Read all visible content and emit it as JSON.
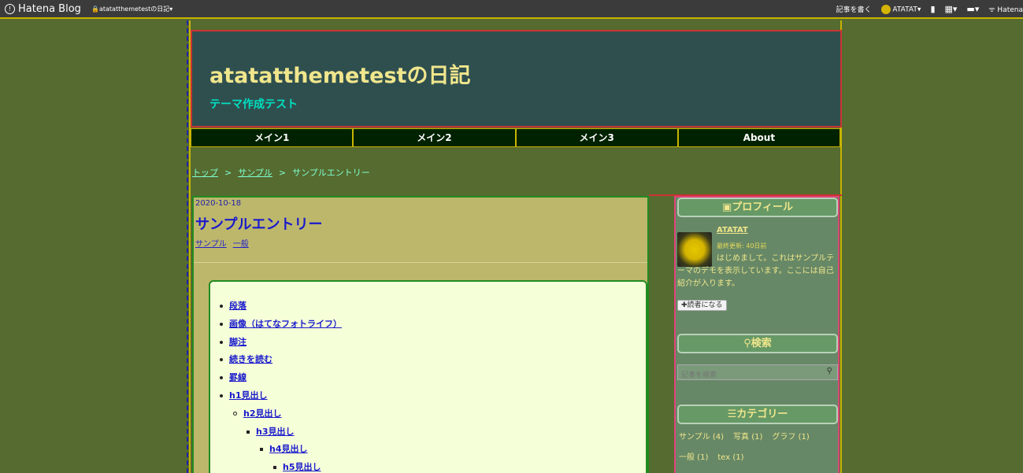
{
  "topbar": {
    "logo": "Hatena Blog",
    "blog_selector": "atatatthemetestの日記",
    "write_link": "記事を書く",
    "user": "ATATAT",
    "hatena": "Hatena"
  },
  "header": {
    "title": "atatatthemetestの日記",
    "description": "テーマ作成テスト"
  },
  "nav": {
    "items": [
      "メイン1",
      "メイン2",
      "メイン3",
      "About"
    ]
  },
  "breadcrumb": {
    "items": [
      "トップ",
      "サンプル",
      "サンプルエントリー"
    ]
  },
  "entry": {
    "date": "2020-10-18",
    "title": "サンプルエントリー",
    "categories": [
      "サンプル",
      "一般"
    ]
  },
  "toc": {
    "items": [
      "段落",
      "画像（はてなフォトライフ）",
      "脚注",
      "続きを読む",
      "罫線",
      "h1見出し",
      "h2見出し",
      "h3見出し",
      "h4見出し",
      "h5見出し"
    ]
  },
  "sidebar": {
    "profile": {
      "title": "プロフィール",
      "name": "ATATAT",
      "updated": "最終更新: 40日前",
      "description": "はじめまして。これはサンプルテーマのデモを表示しています。ここには自己紹介が入ります。",
      "follow_label": "読者になる"
    },
    "search": {
      "title": "検索",
      "placeholder": "記事を検索"
    },
    "categories": {
      "title": "カテゴリー",
      "items": [
        "サンプル (4)",
        "写真 (1)",
        "グラフ (1)",
        "一般 (1)",
        "tex (1)"
      ]
    }
  }
}
